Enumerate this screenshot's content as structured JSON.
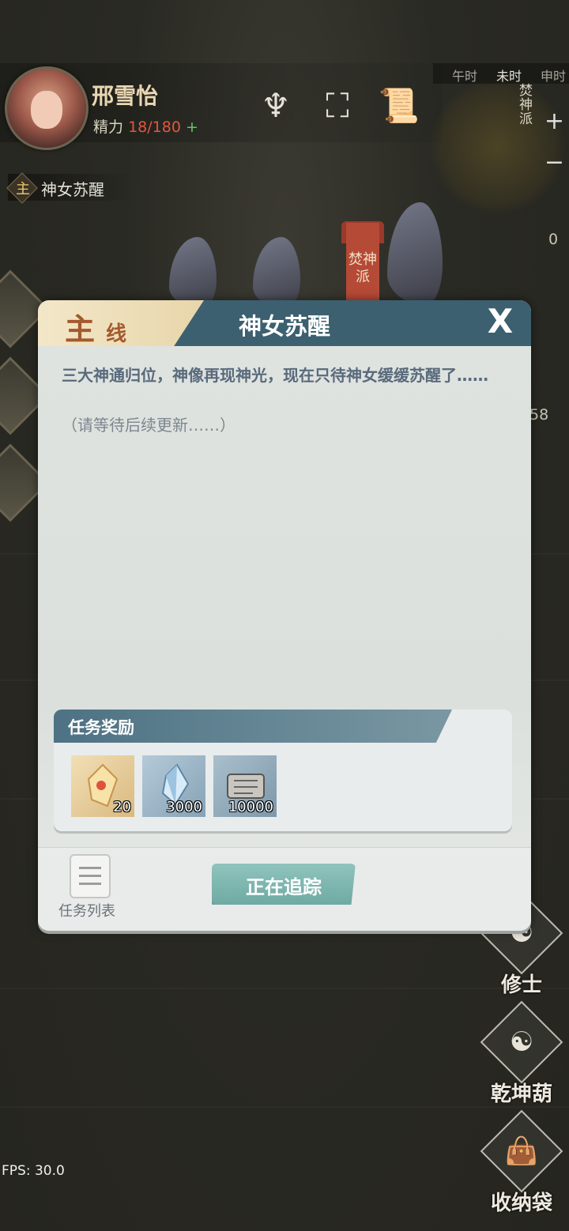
{
  "hud": {
    "player_name": "邢雪怡",
    "stamina_label": "精力",
    "stamina_value": "18/180",
    "stamina_plus": "+",
    "icons": [
      "incense-icon",
      "map-scroll-icon",
      "quest-scroll-icon"
    ]
  },
  "time_bar": {
    "slots": [
      "午时",
      "未时",
      "申时"
    ]
  },
  "minimap": {
    "sect_label": "焚神派",
    "zoom_in": "+",
    "zoom_out": "−"
  },
  "world": {
    "banner_text": "焚神派",
    "right_badge_count": "0",
    "right_count_2": "58"
  },
  "current_quest": {
    "badge": "主",
    "name": "神女苏醒"
  },
  "panel": {
    "tag_main": "主",
    "tag_sub": "线",
    "title": "神女苏醒",
    "close": "X",
    "description": "三大神通归位，神像再现神光，现在只待神女缓缓苏醒了……",
    "note": "（请等待后续更新……）",
    "reward_title": "任务奖励",
    "rewards": [
      {
        "icon": "jade-token-icon",
        "count": "20",
        "color": "#e8c890"
      },
      {
        "icon": "crystal-icon",
        "count": "3000",
        "color": "#9ab5c8"
      },
      {
        "icon": "scroll-icon",
        "count": "10000",
        "color": "#8ea9bb"
      }
    ],
    "list_label": "任务列表",
    "track_label": "正在追踪"
  },
  "right_menu": [
    {
      "label": "修士",
      "icon": "cultivator-icon"
    },
    {
      "label": "乾坤葫",
      "icon": "gourd-icon"
    },
    {
      "label": "收纳袋",
      "icon": "storage-bag-icon"
    }
  ],
  "fps": "FPS: 30.0"
}
